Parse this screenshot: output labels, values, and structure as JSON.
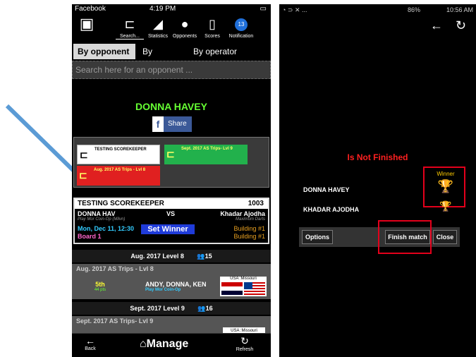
{
  "left": {
    "statusbar": {
      "app": "Facebook",
      "time": "4:19 PM"
    },
    "nav": [
      {
        "label": "Search...",
        "icon": "bracket-icon"
      },
      {
        "label": "Statistics",
        "icon": "chart-icon"
      },
      {
        "label": "Opponents",
        "icon": "people-icon"
      },
      {
        "label": "Scores",
        "icon": "clipboard-icon"
      },
      {
        "label": "Notification",
        "icon": "bell-icon",
        "badge": "13"
      }
    ],
    "tabs": [
      "By opponent",
      "By division",
      "By operator"
    ],
    "search_placeholder": "Search here for an opponent ...",
    "player_name": "DONNA HAVEY",
    "share_label": "Share",
    "chips": [
      {
        "label": "TESTING SCOREKEEPER",
        "color": "#ffffff"
      },
      {
        "label": "Sept. 2017 AS Trips- Lvl 9",
        "color": "#22b14c"
      },
      {
        "label": "Aug. 2017 AS Trips - Lvl 8",
        "color": "#e02020"
      }
    ],
    "match": {
      "title": "TESTING SCOREKEEPER",
      "number": "1003",
      "player1": "DONNA HAV",
      "vs": "VS",
      "player2": "Khadar Ajodha",
      "venue1": "Play Mor Coin-Op (Milvn)",
      "venue2": "Maximum Darts",
      "date": "Mon, Dec 11, 12:30",
      "board": "Board 1",
      "location": "Building #1",
      "location2": "Building #1",
      "set_winner_label": "Set Winner"
    },
    "levels": [
      {
        "title": "Aug. 2017 Level 8",
        "count": "15",
        "sub": "Aug. 2017 AS Trips - Lvl 8",
        "rank": "5th",
        "pts": "44 pts",
        "team": "ANDY, DONNA, KEN",
        "team_venue": "Play Mor Coin-Op",
        "flag_label": "USA :Missouri"
      },
      {
        "title": "Sept. 2017 Level 9",
        "count": "16",
        "sub": "Sept. 2017 AS Trips- Lvl 9",
        "flag_label": "USA :Missouri"
      }
    ],
    "bottom": {
      "back": "Back",
      "manage": "Manage",
      "refresh": "Refresh"
    }
  },
  "right": {
    "statusbar": {
      "battery": "86%",
      "time": "10:56 AM"
    },
    "status_text": "Is Not Finished",
    "winner_label": "Winner",
    "player1": "DONNA HAVEY",
    "player2": "KHADAR AJODHA",
    "buttons": {
      "options": "Options",
      "finish": "Finish match",
      "close": "Close"
    }
  },
  "colors": {
    "accent_green": "#66ff33",
    "highlight_red": "#e3001b",
    "arrow_blue": "#5b9bd5"
  }
}
